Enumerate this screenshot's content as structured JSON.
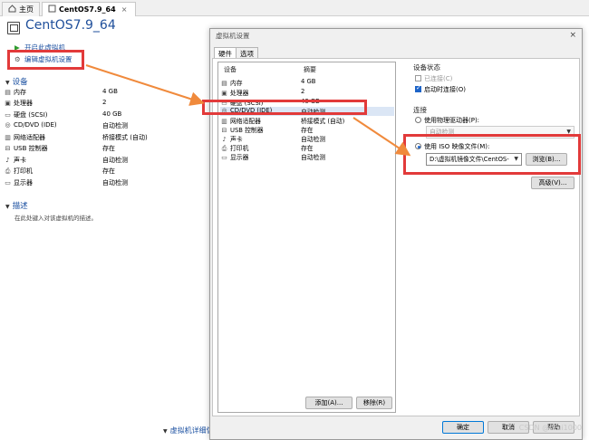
{
  "tabs": [
    {
      "label": "主页",
      "icon": "home-icon"
    },
    {
      "label": "CentOS7.9_64",
      "icon": "vm-icon",
      "close": "×"
    }
  ],
  "vm": {
    "title": "CentOS7.9_64"
  },
  "actions": {
    "power_on": "开启此虚拟机",
    "edit_settings": "编辑虚拟机设置"
  },
  "devices_section": {
    "title": "设备"
  },
  "devices": [
    {
      "name": "内存",
      "value": "4 GB",
      "icon": "memory-icon"
    },
    {
      "name": "处理器",
      "value": "2",
      "icon": "cpu-icon"
    },
    {
      "name": "硬盘 (SCSI)",
      "value": "40 GB",
      "icon": "disk-icon"
    },
    {
      "name": "CD/DVD (IDE)",
      "value": "自动检测",
      "icon": "cd-icon"
    },
    {
      "name": "网络适配器",
      "value": "桥接模式 (自动)",
      "icon": "network-icon"
    },
    {
      "name": "USB 控制器",
      "value": "存在",
      "icon": "usb-icon"
    },
    {
      "name": "声卡",
      "value": "自动检测",
      "icon": "sound-icon"
    },
    {
      "name": "打印机",
      "value": "存在",
      "icon": "printer-icon"
    },
    {
      "name": "显示器",
      "value": "自动检测",
      "icon": "display-icon"
    }
  ],
  "description_section": {
    "title": "描述",
    "note": "在此处键入对该虚拟机的描述。"
  },
  "vm_details_section": {
    "title": "虚拟机详细信息"
  },
  "dialog": {
    "title": "虚拟机设置",
    "close": "×",
    "tabs": [
      "硬件",
      "选项"
    ],
    "list_headers": {
      "device": "设备",
      "summary": "摘要"
    },
    "list": [
      {
        "name": "内存",
        "summary": "4 GB",
        "icon": "memory-icon"
      },
      {
        "name": "处理器",
        "summary": "2",
        "icon": "cpu-icon"
      },
      {
        "name": "硬盘 (SCSI)",
        "summary": "40 GB",
        "icon": "disk-icon"
      },
      {
        "name": "CD/DVD (IDE)",
        "summary": "自动检测",
        "icon": "cd-icon",
        "selected": true
      },
      {
        "name": "网络适配器",
        "summary": "桥接模式 (自动)",
        "icon": "network-icon"
      },
      {
        "name": "USB 控制器",
        "summary": "存在",
        "icon": "usb-icon"
      },
      {
        "name": "声卡",
        "summary": "自动检测",
        "icon": "sound-icon"
      },
      {
        "name": "打印机",
        "summary": "存在",
        "icon": "printer-icon"
      },
      {
        "name": "显示器",
        "summary": "自动检测",
        "icon": "display-icon"
      }
    ],
    "add_button": "添加(A)...",
    "remove_button": "移除(R)",
    "device_status": {
      "title": "设备状态",
      "connected": {
        "label": "已连接(C)",
        "checked": false,
        "disabled": true
      },
      "connect_on_power": {
        "label": "启动时连接(O)",
        "checked": true
      }
    },
    "connection": {
      "title": "连接",
      "use_physical": "使用物理驱动器(P):",
      "physical_value": "自动检测",
      "use_iso": "使用 ISO 映像文件(M):",
      "iso_path": "D:\\虚拟机镜像文件\\CentOS-",
      "browse": "浏览(B)...",
      "selected": "iso"
    },
    "advanced_button": "高级(V)...",
    "ok_button": "确定",
    "cancel_button": "取消",
    "help_button": "帮助"
  },
  "watermark": "CSDN @Etui1000",
  "colors": {
    "highlight": "#e23a3a",
    "arrow": "#f08a3c",
    "link": "#1a4fa0",
    "title": "#1f4f9b"
  }
}
